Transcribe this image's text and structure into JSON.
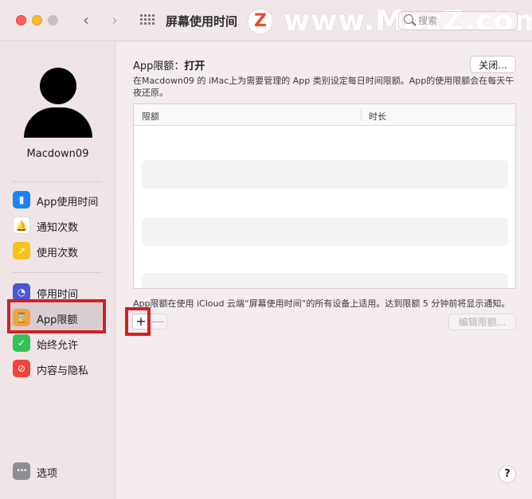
{
  "window": {
    "title": "屏幕使用时间",
    "watermark_logo": "Z",
    "watermark_text": "www.MacZ.com",
    "search_placeholder": "搜索"
  },
  "nav": {
    "back": "‹",
    "forward": "›"
  },
  "sidebar": {
    "user_name": "Macdown09",
    "items": [
      {
        "label": "App使用时间",
        "icon": "bar-chart-icon",
        "glyph": "▮"
      },
      {
        "label": "通知次数",
        "icon": "bell-icon",
        "glyph": "🔔"
      },
      {
        "label": "使用次数",
        "icon": "pickup-icon",
        "glyph": "↗"
      },
      {
        "label": "停用时间",
        "icon": "downtime-icon",
        "glyph": "◔"
      },
      {
        "label": "App限额",
        "icon": "hourglass-icon",
        "glyph": "⌛",
        "selected": true
      },
      {
        "label": "始终允许",
        "icon": "checkmark-icon",
        "glyph": "✓"
      },
      {
        "label": "内容与隐私",
        "icon": "prohibited-icon",
        "glyph": "⊘"
      }
    ],
    "options_label": "选项",
    "options_glyph": "•••"
  },
  "main": {
    "title_prefix": "App限额：",
    "title_status": "打开",
    "off_button": "关闭...",
    "description": "在Macdown09 的 iMac上为需要管理的 App 类别设定每日时间限额。App的使用限额会在每天午夜还原。",
    "table": {
      "col_limit": "限额",
      "col_duration": "时长"
    },
    "footnote": "App限额在使用 iCloud 云端“屏幕使用时间”的所有设备上适用。达到限额 5 分钟前将显示通知。",
    "add_label": "+",
    "remove_label": "—",
    "edit_button": "编辑限额...",
    "help_label": "?"
  },
  "colors": {
    "highlight_red": "#d21f24",
    "accent_blue": "#1b83f2"
  }
}
